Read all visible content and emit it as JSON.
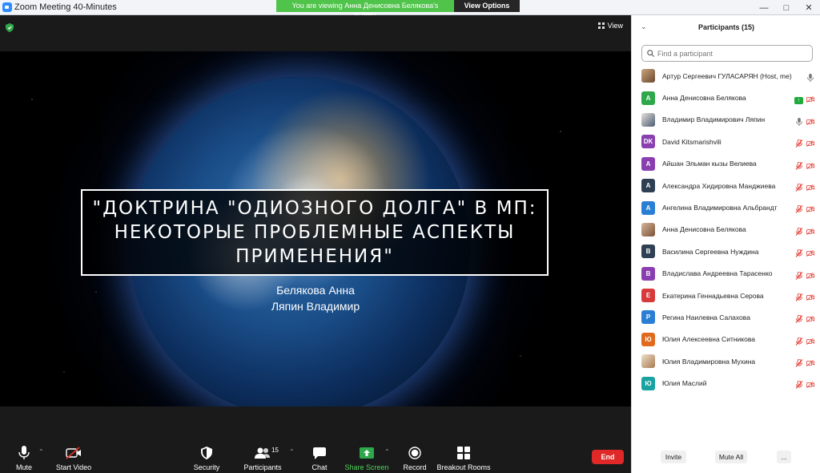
{
  "window": {
    "title": "Zoom Meeting 40-Minutes"
  },
  "banner": {
    "viewing": "You are viewing Анна Денисовна Белякова's screen",
    "view_options": "View Options"
  },
  "meeting": {
    "view_label": "View"
  },
  "slide": {
    "title_lines": [
      "\"ДОКТРИНА \"ОДИОЗНОГО ДОЛГА\" В МП:",
      "НЕКОТОРЫЕ ПРОБЛЕМНЫЕ АСПЕКТЫ",
      "ПРИМЕНЕНИЯ\""
    ],
    "authors": [
      "Белякова Анна",
      "Ляпин Владимир"
    ]
  },
  "toolbar": {
    "mute": "Mute",
    "start_video": "Start Video",
    "security": "Security",
    "participants": "Participants",
    "participants_count": "15",
    "chat": "Chat",
    "share_screen": "Share Screen",
    "record": "Record",
    "breakout_rooms": "Breakout Rooms",
    "end": "End"
  },
  "panel": {
    "title": "Participants (15)",
    "search_placeholder": "Find a participant",
    "participants": [
      {
        "name": "Артур Сергеевич ГУЛАСАРЯН (Host, me)",
        "initial": "",
        "color": "",
        "avatar": "photo",
        "icons": "mic"
      },
      {
        "name": "Анна Денисовна Белякова",
        "initial": "A",
        "color": "#2ea84a",
        "avatar": "letter",
        "icons": "share-videooff"
      },
      {
        "name": "Владимир Владимирович Ляпин",
        "initial": "",
        "color": "",
        "avatar": "photo2",
        "icons": "mic-videooff"
      },
      {
        "name": "David Kitsmarishvili",
        "initial": "DK",
        "color": "#8a3fb0",
        "avatar": "letter",
        "icons": "mute-videooff"
      },
      {
        "name": "Айшан Эльман кызы Велиева",
        "initial": "A",
        "color": "#8a3fb0",
        "avatar": "letter",
        "icons": "mute-videooff"
      },
      {
        "name": "Александра Хидировна Манджиева",
        "initial": "A",
        "color": "#2f3f54",
        "avatar": "letter",
        "icons": "mute-videooff"
      },
      {
        "name": "Ангелина Владимировна Альбрандт",
        "initial": "A",
        "color": "#2a7fd4",
        "avatar": "letter",
        "icons": "mute-videooff"
      },
      {
        "name": "Анна Денисовна Белякова",
        "initial": "",
        "color": "",
        "avatar": "photo3",
        "icons": "mute-videooff"
      },
      {
        "name": "Василина Сергеевна Нуждина",
        "initial": "B",
        "color": "#2f3f54",
        "avatar": "letter",
        "icons": "mute-videooff"
      },
      {
        "name": "Владислава Андреевна Тарасенко",
        "initial": "B",
        "color": "#8a3fb0",
        "avatar": "letter",
        "icons": "mute-videooff"
      },
      {
        "name": "Екатерина Геннадьевна Серова",
        "initial": "E",
        "color": "#d63a3a",
        "avatar": "letter",
        "icons": "mute-videooff"
      },
      {
        "name": "Регина Наилевна Салахова",
        "initial": "P",
        "color": "#2a7fd4",
        "avatar": "letter",
        "icons": "mute-videooff"
      },
      {
        "name": "Юлия Алексеевна Ситникова",
        "initial": "Ю",
        "color": "#e06a1e",
        "avatar": "letter",
        "icons": "mute-videooff"
      },
      {
        "name": "Юлия Владимировна Мухина",
        "initial": "",
        "color": "",
        "avatar": "photo4",
        "icons": "mute-videooff"
      },
      {
        "name": "Юлия Маслий",
        "initial": "Ю",
        "color": "#19a2a0",
        "avatar": "letter",
        "icons": "mute-videooff"
      }
    ],
    "footer": {
      "invite": "Invite",
      "mute_all": "Mute All",
      "more": "..."
    }
  },
  "colors": {
    "accent": "#2d8cff",
    "share_green": "#4fc34a",
    "end_red": "#e02828",
    "muted_red": "#e0352b"
  }
}
